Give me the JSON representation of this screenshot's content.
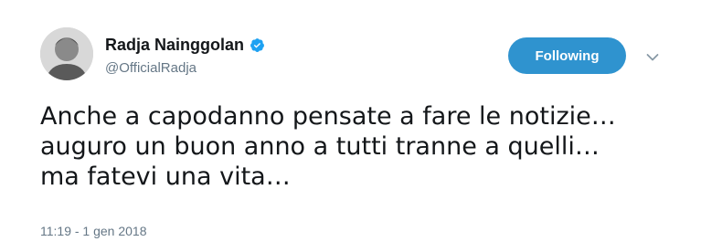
{
  "author": {
    "display_name": "Radja Nainggolan",
    "handle": "@OfficialRadja",
    "verified": true
  },
  "follow_button": {
    "label": "Following"
  },
  "icons": {
    "verified": "verified-badge-icon",
    "menu": "chevron-down-icon",
    "avatar": "profile-photo"
  },
  "tweet": {
    "lines": [
      "Anche a capodanno pensate a fare le notizie…",
      "auguro un buon anno a tutti tranne a quelli…",
      "ma fatevi una vita…"
    ],
    "timestamp": "11:19 - 1 gen 2018"
  },
  "colors": {
    "follow_button": "#2f93cf",
    "verified_badge": "#1da1f2",
    "secondary_text": "#657786"
  }
}
